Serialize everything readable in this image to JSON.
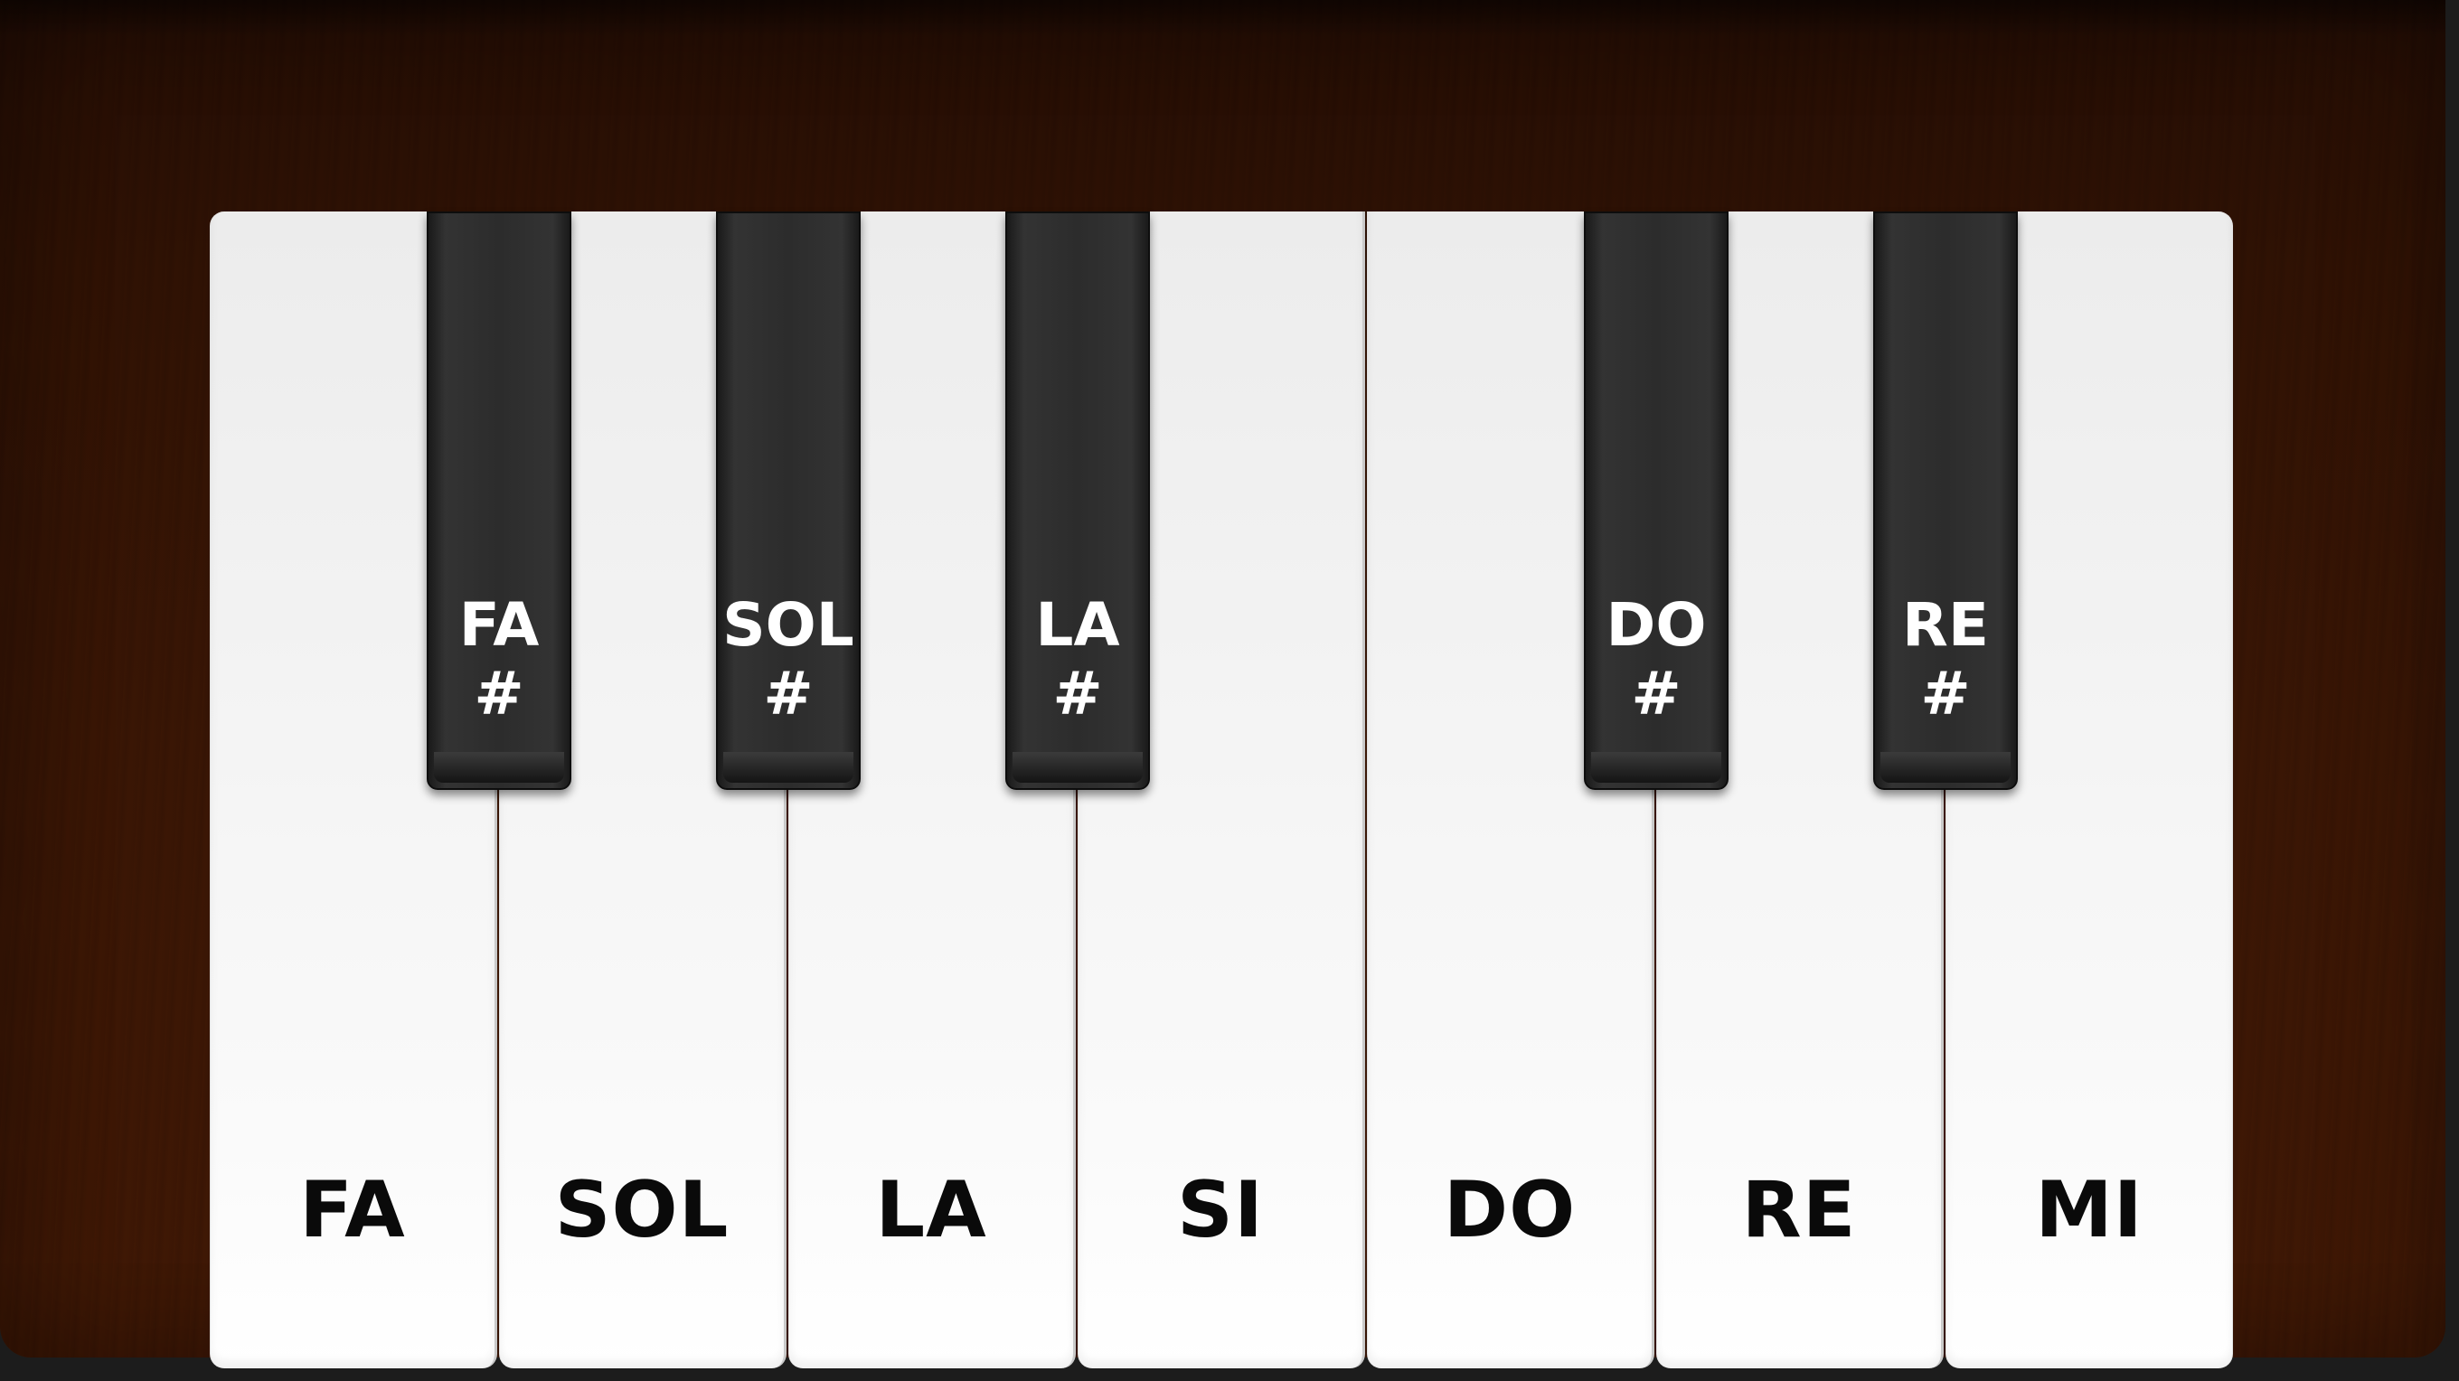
{
  "piano": {
    "white_keys": [
      {
        "label": "FA"
      },
      {
        "label": "SOL"
      },
      {
        "label": "LA"
      },
      {
        "label": "SI"
      },
      {
        "label": "DO"
      },
      {
        "label": "RE"
      },
      {
        "label": "MI"
      }
    ],
    "black_keys": [
      {
        "label": "FA\n#"
      },
      {
        "label": "SOL\n#"
      },
      {
        "label": "LA\n#"
      },
      {
        "label": "DO\n#"
      },
      {
        "label": "RE\n#"
      }
    ]
  }
}
